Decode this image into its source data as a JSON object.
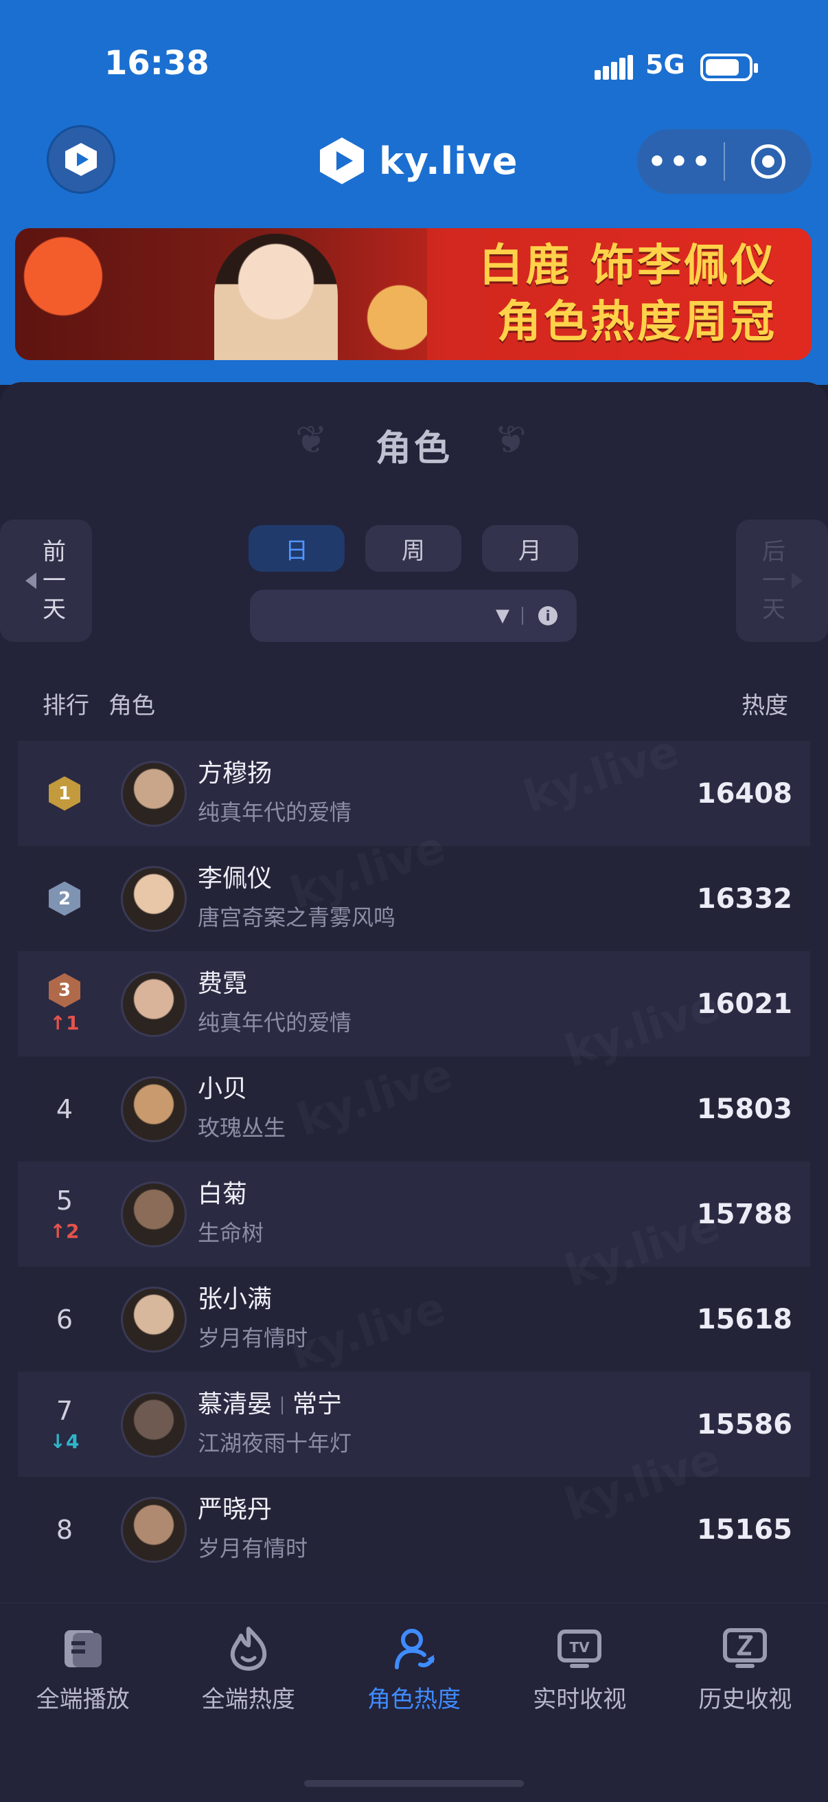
{
  "status_bar": {
    "time": "16:38",
    "network": "5G"
  },
  "header": {
    "logo_text": "ky.live",
    "menu_dots": "•••"
  },
  "banner": {
    "line1": "白鹿 饰李佩仪",
    "line2": "角色热度周冠"
  },
  "section": {
    "title": "角色"
  },
  "day_nav": {
    "prev": [
      "前",
      "一",
      "天"
    ],
    "next": [
      "后",
      "一",
      "天"
    ]
  },
  "tabs": [
    {
      "label": "日",
      "active": true
    },
    {
      "label": "周",
      "active": false
    },
    {
      "label": "月",
      "active": false
    }
  ],
  "date_selector": {
    "text": ""
  },
  "table": {
    "headers": {
      "rank": "排行",
      "role": "角色",
      "heat": "热度"
    },
    "rows": [
      {
        "rank": "1",
        "medal": "gold",
        "change": "",
        "name": "方穆扬",
        "name2": "",
        "show": "纯真年代的爱情",
        "heat": "16408",
        "avatar_color": "#c9a68a"
      },
      {
        "rank": "2",
        "medal": "silver",
        "change": "",
        "name": "李佩仪",
        "name2": "",
        "show": "唐宫奇案之青雾风鸣",
        "heat": "16332",
        "avatar_color": "#e8c7a8"
      },
      {
        "rank": "3",
        "medal": "bronze",
        "change": "1",
        "change_dir": "up",
        "name": "费霓",
        "name2": "",
        "show": "纯真年代的爱情",
        "heat": "16021",
        "avatar_color": "#d9b49a"
      },
      {
        "rank": "4",
        "medal": "",
        "change": "",
        "name": "小贝",
        "name2": "",
        "show": "玫瑰丛生",
        "heat": "15803",
        "avatar_color": "#c89a6e"
      },
      {
        "rank": "5",
        "medal": "",
        "change": "2",
        "change_dir": "up",
        "name": "白菊",
        "name2": "",
        "show": "生命树",
        "heat": "15788",
        "avatar_color": "#8a6c58"
      },
      {
        "rank": "6",
        "medal": "",
        "change": "",
        "name": "张小满",
        "name2": "",
        "show": "岁月有情时",
        "heat": "15618",
        "avatar_color": "#d8b89c"
      },
      {
        "rank": "7",
        "medal": "",
        "change": "4",
        "change_dir": "down",
        "name": "慕清晏",
        "name2": "常宁",
        "show": "江湖夜雨十年灯",
        "heat": "15586",
        "avatar_color": "#6e5a50"
      },
      {
        "rank": "8",
        "medal": "",
        "change": "",
        "name": "严晓丹",
        "name2": "",
        "show": "岁月有情时",
        "heat": "15165",
        "avatar_color": "#b08a70"
      }
    ]
  },
  "bottom_nav": [
    {
      "label": "全端播放",
      "icon": "play-list-icon",
      "active": false
    },
    {
      "label": "全端热度",
      "icon": "flame-icon",
      "active": false
    },
    {
      "label": "角色热度",
      "icon": "person-icon",
      "active": true
    },
    {
      "label": "实时收视",
      "icon": "tv-icon",
      "active": false
    },
    {
      "label": "历史收视",
      "icon": "history-icon",
      "active": false
    }
  ],
  "colors": {
    "brand_blue": "#1b6fd0",
    "panel": "#23233a",
    "active_tab": "#4f95ff",
    "up": "#e5534b",
    "down": "#2fb5c8",
    "banner_gold": "#ffd24a"
  }
}
